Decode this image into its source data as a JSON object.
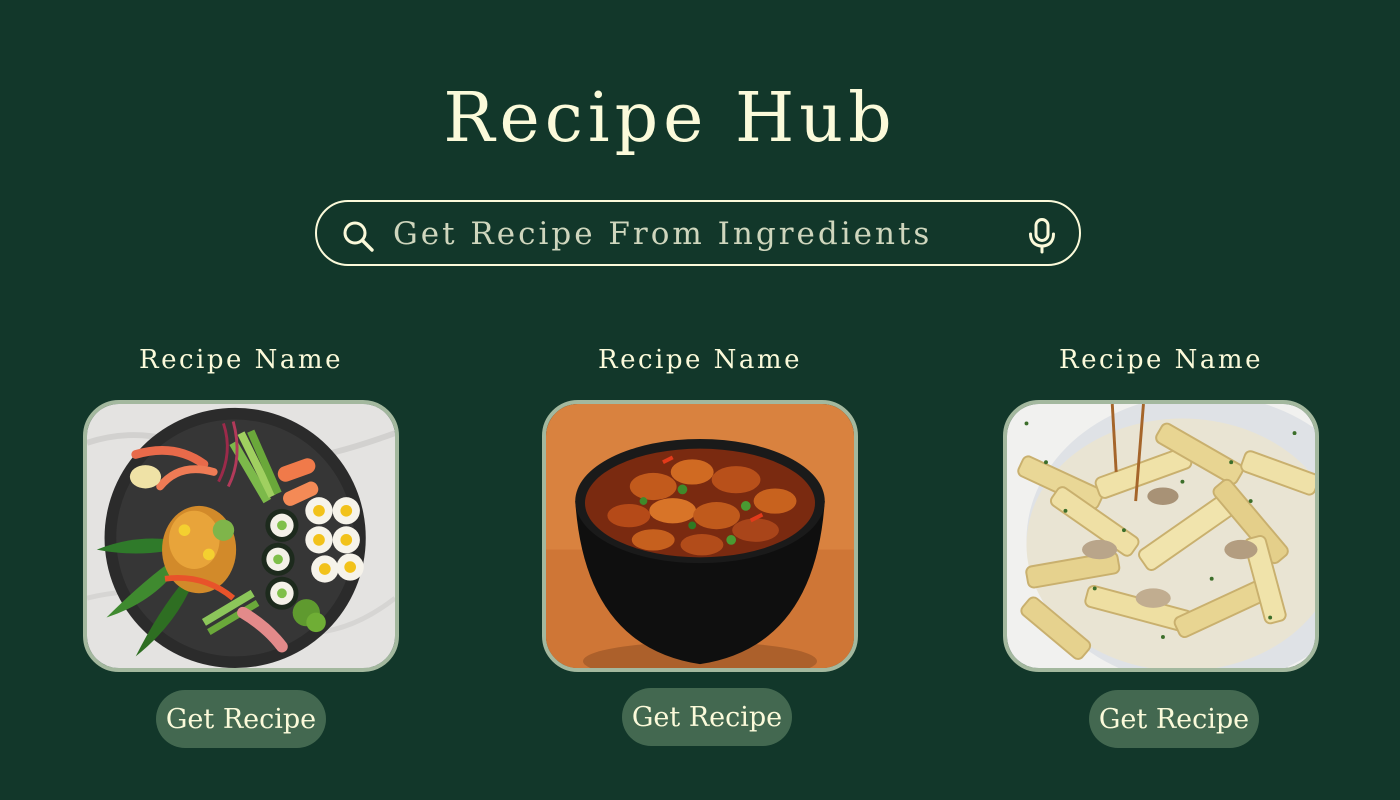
{
  "header": {
    "title": "Recipe Hub"
  },
  "search": {
    "placeholder": "Get Recipe From Ingredients",
    "left_icon": "search-icon",
    "right_icon": "microphone-icon"
  },
  "recipes": [
    {
      "name": "Recipe Name",
      "image": "sushi-platter",
      "button_label": "Get Recipe"
    },
    {
      "name": "Recipe Name",
      "image": "curry-bowl",
      "button_label": "Get Recipe"
    },
    {
      "name": "Recipe Name",
      "image": "creamy-penne-pasta",
      "button_label": "Get Recipe"
    }
  ],
  "colors": {
    "background": "#12372a",
    "text": "#fbfada",
    "button": "#436850",
    "image_border": "#a3b89e"
  }
}
